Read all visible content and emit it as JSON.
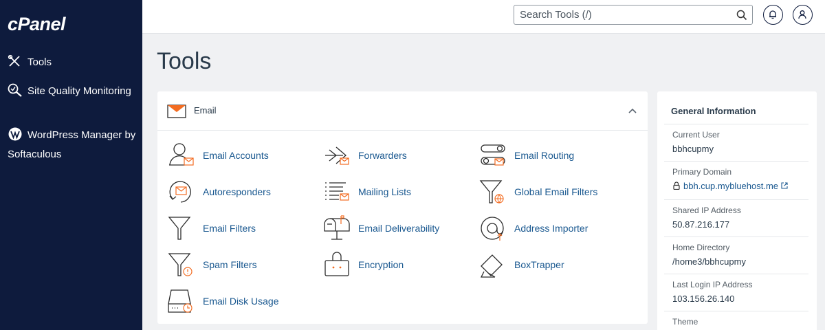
{
  "sidebar": {
    "logo": "cPanel",
    "items": [
      {
        "label": "Tools"
      },
      {
        "label": "Site Quality Monitoring"
      },
      {
        "label": "WordPress Manager by Softaculous"
      }
    ]
  },
  "header": {
    "search": {
      "placeholder": "Search Tools (/)",
      "value": ""
    }
  },
  "page": {
    "title": "Tools"
  },
  "email_section": {
    "label": "Email",
    "tools": [
      {
        "label": "Email Accounts",
        "icon": "email-accounts-icon"
      },
      {
        "label": "Forwarders",
        "icon": "forwarders-icon"
      },
      {
        "label": "Email Routing",
        "icon": "email-routing-icon"
      },
      {
        "label": "Autoresponders",
        "icon": "autoresponders-icon"
      },
      {
        "label": "Mailing Lists",
        "icon": "mailing-lists-icon"
      },
      {
        "label": "Global Email Filters",
        "icon": "global-email-filters-icon"
      },
      {
        "label": "Email Filters",
        "icon": "email-filters-icon"
      },
      {
        "label": "Email Deliverability",
        "icon": "email-deliverability-icon"
      },
      {
        "label": "Address Importer",
        "icon": "address-importer-icon"
      },
      {
        "label": "Spam Filters",
        "icon": "spam-filters-icon"
      },
      {
        "label": "Encryption",
        "icon": "encryption-icon"
      },
      {
        "label": "BoxTrapper",
        "icon": "boxtrapper-icon"
      },
      {
        "label": "Email Disk Usage",
        "icon": "email-disk-usage-icon"
      }
    ]
  },
  "general_info": {
    "title": "General Information",
    "rows": [
      {
        "label": "Current User",
        "value": "bbhcupmy"
      },
      {
        "label": "Primary Domain",
        "value": "bbh.cup.mybluehost.me"
      },
      {
        "label": "Shared IP Address",
        "value": "50.87.216.177"
      },
      {
        "label": "Home Directory",
        "value": "/home3/bbhcupmy"
      },
      {
        "label": "Last Login IP Address",
        "value": "103.156.26.140"
      },
      {
        "label": "Theme",
        "value": ""
      }
    ]
  },
  "colors": {
    "sidebar_bg": "#0e1b3d",
    "accent_orange": "#f36c21",
    "link_blue": "#18578f",
    "icon_dark": "#2b2b2b"
  }
}
